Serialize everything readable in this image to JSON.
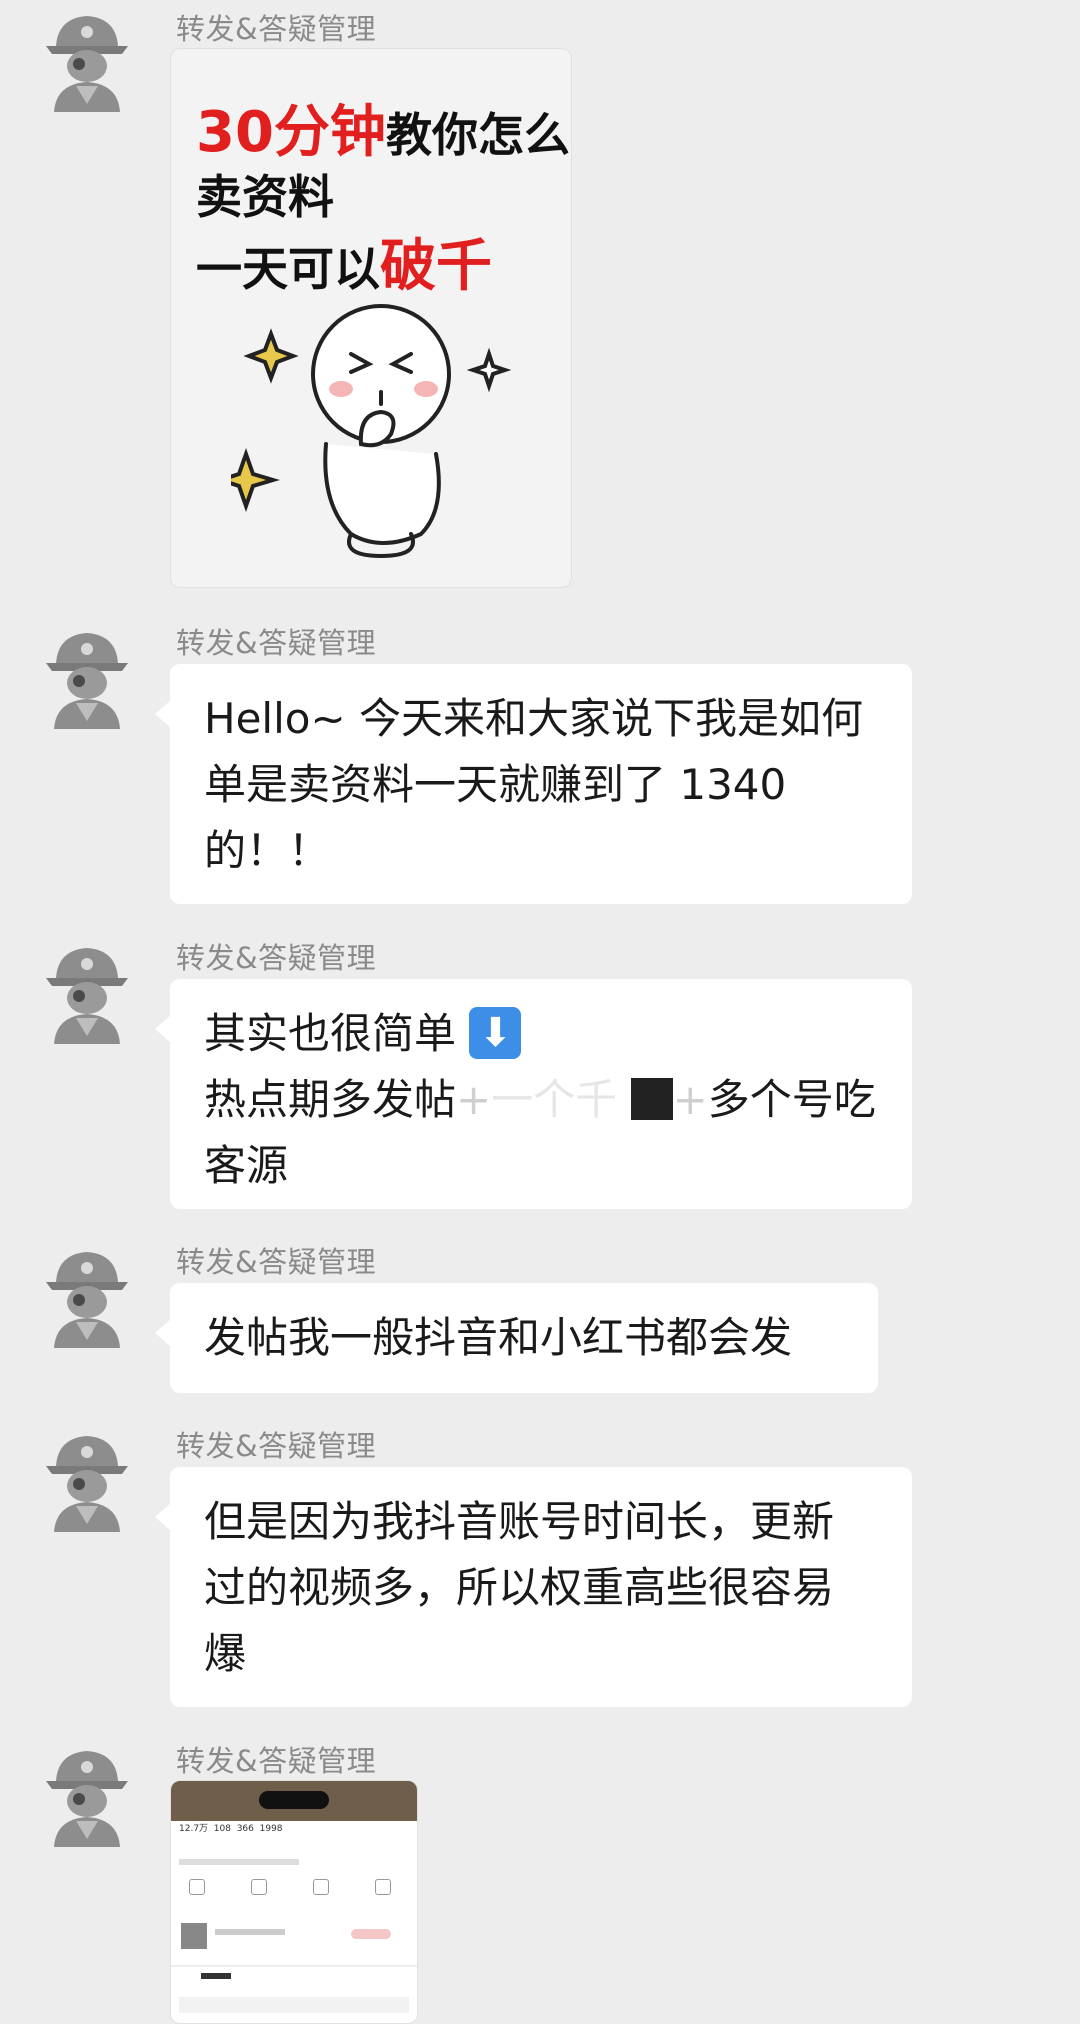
{
  "messages": [
    {
      "sender": "转发&答疑管理",
      "type": "image-poster",
      "poster": {
        "line1_red": "30分钟",
        "line1_rest": "教你怎么",
        "line2": "卖资料",
        "line3_black": "一天可以",
        "line3_red": "破千"
      }
    },
    {
      "sender": "转发&答疑管理",
      "type": "text",
      "lines": [
        "Hello~ 今天来和大家说下我是如何",
        "单是卖资料一天就赚到了 1340",
        "的！！"
      ]
    },
    {
      "sender": "转发&答疑管理",
      "type": "text",
      "line1": "其实也很简单",
      "line1_emoji": "down-arrow-emoji",
      "line2_a": "热点期多发帖",
      "line2_plus1": "+",
      "line2_blur": "一个千",
      "line2_plus2": "+",
      "line2_b": "多个号吃",
      "line3": "客源"
    },
    {
      "sender": "转发&答疑管理",
      "type": "text",
      "lines": [
        "发帖我一般抖音和小红书都会发"
      ]
    },
    {
      "sender": "转发&答疑管理",
      "type": "text",
      "lines": [
        "但是因为我抖音账号时间长，更新",
        "过的视频多，所以权重高些很容易",
        "爆"
      ]
    },
    {
      "sender": "转发&答疑管理",
      "type": "image-screenshot",
      "stats": [
        "12.7万",
        "108",
        "366",
        "1998"
      ]
    }
  ],
  "colors": {
    "background": "#ededed",
    "bubble": "#ffffff",
    "sender": "#8a8a8a",
    "poster_red": "#e21f1f"
  },
  "icons": {
    "avatar": "pirate-avatar-icon"
  }
}
